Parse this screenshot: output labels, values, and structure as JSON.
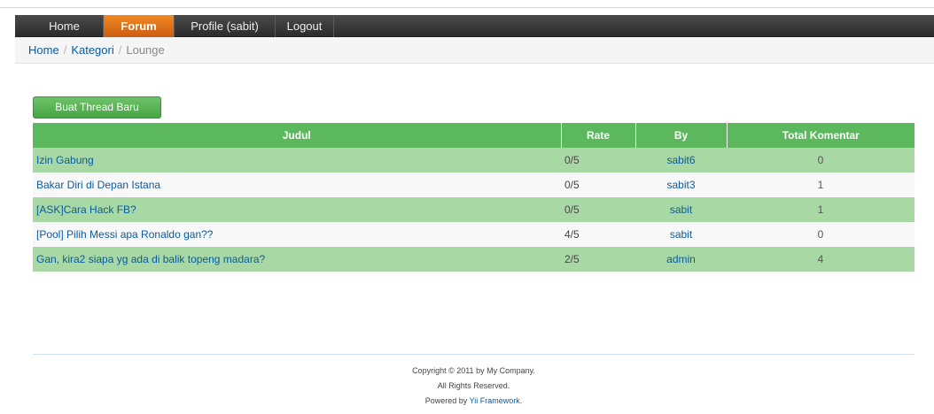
{
  "nav": {
    "items": [
      {
        "label": "Home"
      },
      {
        "label": "Forum"
      },
      {
        "label": "Profile (sabit)"
      },
      {
        "label": "Logout"
      }
    ]
  },
  "breadcrumb": {
    "home": "Home",
    "separator": "/",
    "category": "Kategori",
    "current": "Lounge"
  },
  "actions": {
    "new_thread_label": "Buat Thread Baru"
  },
  "table": {
    "headers": {
      "title": "Judul",
      "rate": "Rate",
      "by": "By",
      "total": "Total Komentar"
    },
    "rows": [
      {
        "title": "Izin Gabung",
        "rate": "0/5",
        "by": "sabit6",
        "total": "0"
      },
      {
        "title": "Bakar Diri di Depan Istana",
        "rate": "0/5",
        "by": "sabit3",
        "total": "1"
      },
      {
        "title": "[ASK]Cara Hack FB?",
        "rate": "0/5",
        "by": "sabit",
        "total": "1"
      },
      {
        "title": "[Pool] Pilih Messi apa Ronaldo gan??",
        "rate": "4/5",
        "by": "sabit",
        "total": "0"
      },
      {
        "title": "Gan, kira2 siapa yg ada di balik topeng madara?",
        "rate": "2/5",
        "by": "admin",
        "total": "4"
      }
    ]
  },
  "footer": {
    "copyright": "Copyright © 2011 by My Company.",
    "rights": "All Rights Reserved.",
    "powered_prefix": "Powered by ",
    "powered_link": "Yii Framework",
    "powered_suffix": "."
  },
  "colors": {
    "nav_active": "#e8791b",
    "header_green": "#5cb85c",
    "row_green": "#a8d9a5",
    "link_blue": "#0b5a9e"
  }
}
